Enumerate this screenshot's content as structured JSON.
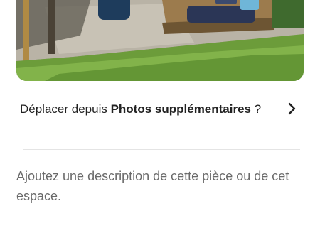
{
  "photo": {
    "subject": "garden-pallet-lounge-photo"
  },
  "move_row": {
    "prefix": "Déplacer depuis ",
    "bold": "Photos supplémentaires",
    "suffix": " ?",
    "icon": "chevron-right-icon"
  },
  "description": {
    "placeholder": "Ajoutez une description de cette pièce ou de cet espace.",
    "value": ""
  },
  "colors": {
    "text": "#222222",
    "placeholder": "#6a6a6a",
    "divider": "#e4e4e4"
  }
}
